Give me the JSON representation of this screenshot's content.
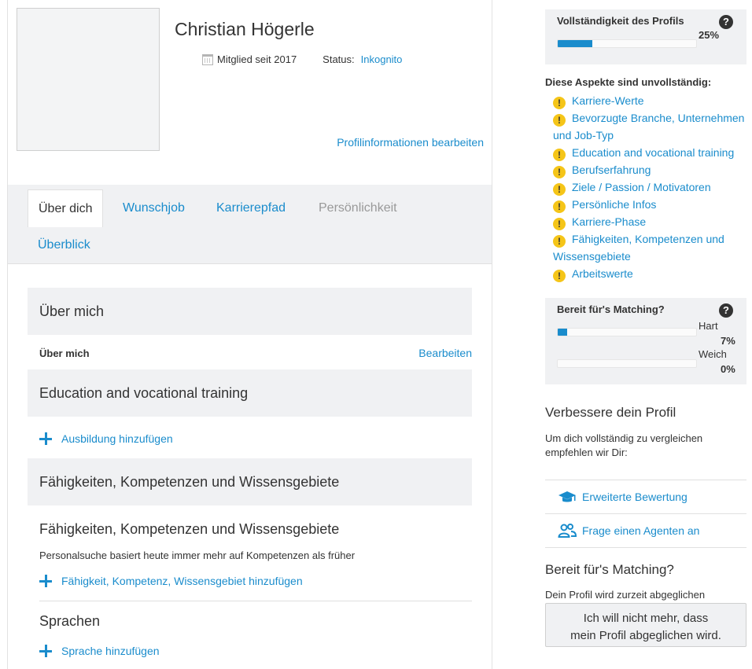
{
  "profile": {
    "name": "Christian Högerle",
    "member_since": "Mitglied seit 2017",
    "status_label": "Status:",
    "status_value": "Inkognito",
    "edit_link": "Profilinformationen bearbeiten"
  },
  "tabs": [
    {
      "label": "Über dich",
      "state": "active"
    },
    {
      "label": "Wunschjob",
      "state": "link"
    },
    {
      "label": "Karrierepfad",
      "state": "link"
    },
    {
      "label": "Persönlichkeit",
      "state": "disabled"
    },
    {
      "label": "Überblick",
      "state": "link"
    }
  ],
  "about": {
    "section_title": "Über mich",
    "row_label": "Über mich",
    "edit_label": "Bearbeiten"
  },
  "education": {
    "section_title": "Education and vocational training",
    "add_label": "Ausbildung hinzufügen"
  },
  "skills": {
    "section_title": "Fähigkeiten, Kompetenzen und Wissensgebiete",
    "sub_title": "Fähigkeiten, Kompetenzen und Wissensgebiete",
    "description": "Personalsuche basiert heute immer mehr auf Kompetenzen als früher",
    "add_label": "Fähigkeit, Kompetenz, Wissensgebiet hinzufügen"
  },
  "languages": {
    "title": "Sprachen",
    "add_label": "Sprache hinzufügen"
  },
  "completeness": {
    "title": "Vollständigkeit des Profils",
    "percent": 25,
    "percent_label": "25%"
  },
  "incomplete": {
    "title": "Diese Aspekte sind unvollständig:",
    "items": [
      "Karriere-Werte",
      "Bevorzugte Branche, Unternehmen und Job-Typ",
      "Education and vocational training",
      "Berufserfahrung",
      "Ziele / Passion / Motivatoren",
      "Persönliche Infos",
      "Karriere-Phase",
      "Fähigkeiten, Kompetenzen und Wissensgebiete",
      "Arbeitswerte"
    ]
  },
  "matching_panel": {
    "title": "Bereit für's Matching?",
    "hard_label": "Hart",
    "hard_percent": 7,
    "hard_percent_label": "7%",
    "soft_label": "Weich",
    "soft_percent": 0,
    "soft_percent_label": "0%"
  },
  "improve": {
    "title": "Verbessere dein Profil",
    "description": "Um dich vollständig zu vergleichen empfehlen wir Dir:",
    "items": [
      {
        "label": "Erweiterte Bewertung",
        "icon": "graduation-cap-icon"
      },
      {
        "label": "Frage einen Agenten an",
        "icon": "users-icon"
      }
    ]
  },
  "matching": {
    "title": "Bereit für's Matching?",
    "description": "Dein Profil wird zurzeit abgeglichen",
    "button_line1": "Ich will nicht mehr, dass",
    "button_line2": "mein Profil abgeglichen wird."
  },
  "colors": {
    "accent": "#1a8ccc",
    "panel_bg": "#f0f1f3",
    "warning": "#f5c518"
  }
}
